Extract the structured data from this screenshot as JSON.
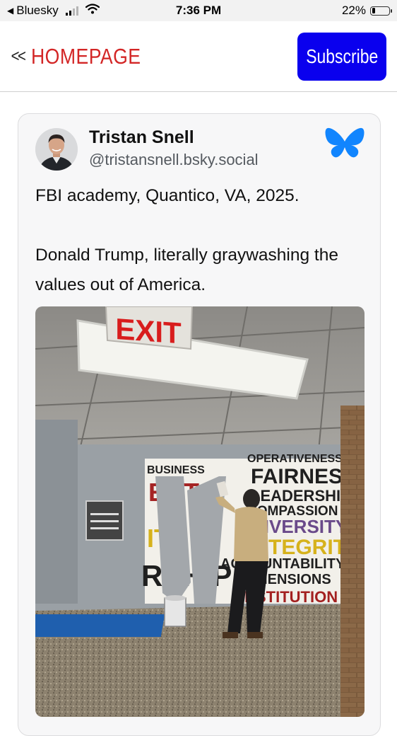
{
  "status_bar": {
    "carrier": "Bluesky",
    "time": "7:36 PM",
    "battery_percent": "22%",
    "battery_level": 0.22
  },
  "nav": {
    "back_label": "HOMEPAGE",
    "subscribe_label": "Subscribe",
    "colors": {
      "title": "#d32626",
      "subscribe_bg": "#0a00ee"
    }
  },
  "post": {
    "author_name": "Tristan Snell",
    "author_handle": "@tristansnell.bsky.social",
    "text_line1": "FBI academy, Quantico, VA, 2025.",
    "text_line2": "Donald Trump, literally graywashing the values out of America.",
    "logo_icon": "bluesky-butterfly-icon",
    "logo_color": "#1185fe",
    "image_sign_text": "EXIT",
    "image_wall_words": [
      "OPERATIVENESS",
      "FAIRNESS",
      "LEADERSHIP",
      "COMPASSION",
      "DIVERSITY",
      "INTEGRITY",
      "ACCOUNTABILITY",
      "DIMENSIONS",
      "INSTITUTION",
      "INITIATIVE",
      "RESPECT",
      "BUSINESS"
    ]
  }
}
